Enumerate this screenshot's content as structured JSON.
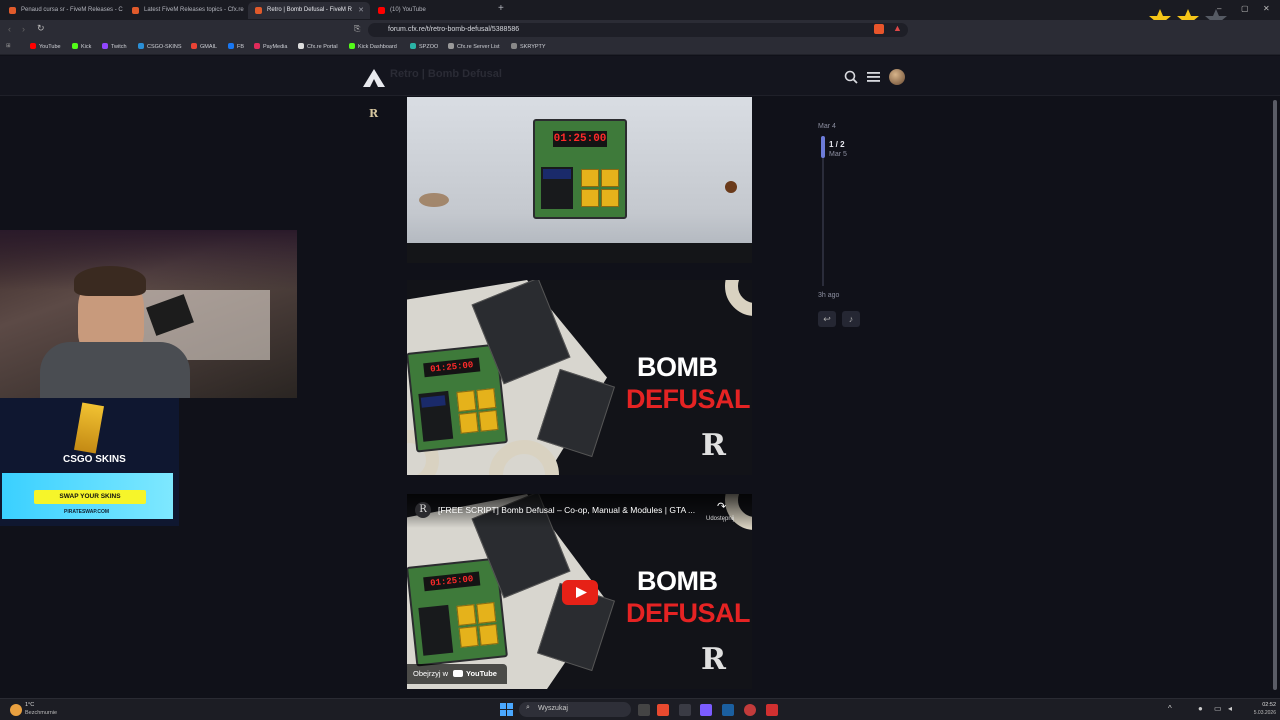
{
  "browser": {
    "tabs": [
      {
        "label": "Penaud cursa sr - FiveM Releases - C",
        "fav": "#e05a2b"
      },
      {
        "label": "Latest FiveM Releases topics - Cfx.re",
        "fav": "#e05a2b"
      },
      {
        "label": "Retro | Bomb Defusal - FiveM R",
        "fav": "#e05a2b",
        "active": true
      },
      {
        "label": "(10) YouTube",
        "fav": "#ff0000"
      }
    ],
    "new_tab": "+",
    "url": "forum.cfx.re/t/retro-bomb-defusal/5388586",
    "bookmarks": [
      "YouTube",
      "Kick",
      "Twitch",
      "CSGO-SKINS",
      "GMAIL",
      "FB",
      "PayMedia",
      "Cfx.re Portal",
      "Kick Dashboard",
      "SPZOO",
      "Cfx.re Server List",
      "SKRYPTY"
    ]
  },
  "forum": {
    "title": "Retro | Bomb Defusal",
    "author_badge": "R"
  },
  "post_images": {
    "timer_display": "01:25:00",
    "promo_line1": "BOMB",
    "promo_line2": "DEFUSAL"
  },
  "video": {
    "title": "[FREE SCRIPT] Bomb Defusal – Co-op, Manual & Modules | GTA ...",
    "share_label": "Udostępnij",
    "watch_on": "Obejrzyj w",
    "watch_brand": "YouTube"
  },
  "ad": {
    "brand": "CSGO SKINS",
    "cta": "SWAP YOUR SKINS",
    "site": "PIRATESWAP.COM"
  },
  "timeline": {
    "start": "Mar 4",
    "position": "1 / 2",
    "position_date": "Mar 5",
    "end": "3h ago"
  },
  "taskbar": {
    "weather_temp": "1°C",
    "weather_desc": "Bezchmurnie",
    "search": "Wyszukaj",
    "time": "02:52",
    "date": "5.03.2026"
  },
  "colors": {
    "accent": "#6c7bd8",
    "red": "#e52323"
  }
}
